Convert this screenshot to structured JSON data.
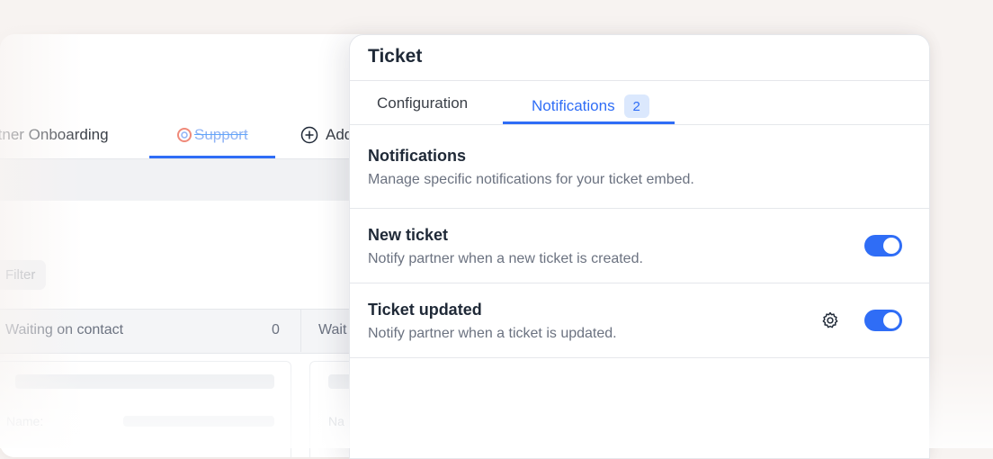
{
  "background": {
    "tabs": [
      {
        "label": "rtner Onboarding"
      },
      {
        "label": "Support"
      },
      {
        "label": "Add"
      }
    ],
    "filter_label": "Filter",
    "columns": [
      {
        "title": "Waiting on contact",
        "count": "0"
      },
      {
        "title": "Wait"
      }
    ],
    "card_field_label": "Name:",
    "card_field_label_short": "Na"
  },
  "panel": {
    "title": "Ticket",
    "tabs": [
      {
        "label": "Configuration"
      },
      {
        "label": "Notifications",
        "badge": "2"
      }
    ],
    "section": {
      "title": "Notifications",
      "description": "Manage specific notifications for your ticket embed."
    },
    "notifications": [
      {
        "title": "New ticket",
        "description": "Notify partner when a new ticket is created.",
        "enabled": true
      },
      {
        "title": "Ticket updated",
        "description": "Notify partner when a ticket is updated.",
        "enabled": true
      }
    ]
  },
  "colors": {
    "accent": "#2f6df6",
    "badge_bg": "#dbe8fd"
  }
}
